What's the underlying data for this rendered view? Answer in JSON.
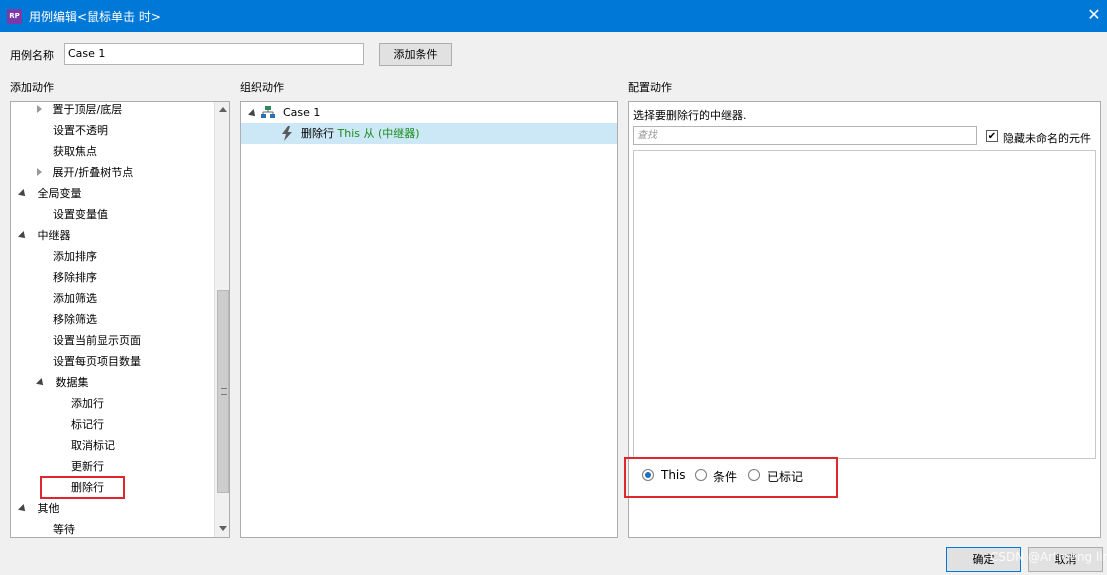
{
  "window": {
    "title": "用例编辑<鼠标单击 时>",
    "app_icon": "RP",
    "close": "✕"
  },
  "case_name": {
    "label": "用例名称",
    "value": "Case 1"
  },
  "add_condition_label": "添加条件",
  "add_action": {
    "heading": "添加动作",
    "items": [
      {
        "label": "置于顶层/底层"
      },
      {
        "label": "设置不透明"
      },
      {
        "label": "获取焦点"
      },
      {
        "label": "展开/折叠树节点"
      },
      {
        "label": "全局变量"
      },
      {
        "label": "设置变量值"
      },
      {
        "label": "中继器"
      },
      {
        "label": "添加排序"
      },
      {
        "label": "移除排序"
      },
      {
        "label": "添加筛选"
      },
      {
        "label": "移除筛选"
      },
      {
        "label": "设置当前显示页面"
      },
      {
        "label": "设置每页项目数量"
      },
      {
        "label": "数据集"
      },
      {
        "label": "添加行"
      },
      {
        "label": "标记行"
      },
      {
        "label": "取消标记"
      },
      {
        "label": "更新行"
      },
      {
        "label": "删除行"
      },
      {
        "label": "其他"
      },
      {
        "label": "等待"
      }
    ]
  },
  "organize": {
    "heading": "组织动作",
    "case_label": "Case 1",
    "action_verb": "删除行",
    "action_detail": "This 从 (中继器)"
  },
  "configure": {
    "heading": "配置动作",
    "instruction": "选择要删除行的中继器.",
    "search_placeholder": "查找",
    "hide_unnamed_label": "隐藏未命名的元件",
    "hide_unnamed_checked": true,
    "options": [
      {
        "label": "This",
        "selected": true
      },
      {
        "label": "条件",
        "selected": false
      },
      {
        "label": "已标记",
        "selected": false
      }
    ]
  },
  "footer": {
    "ok_label": "确定",
    "cancel_label": "取消",
    "watermark": "CSDN @Ar​tmeng lin"
  },
  "colors": {
    "titlebar": "#0078d7",
    "highlight_box": "#e0262d",
    "selected_row": "#cce8f6",
    "action_detail": "#1a8a1a"
  },
  "icons": {
    "case": "case-flow-icon",
    "action": "lightning-icon"
  }
}
